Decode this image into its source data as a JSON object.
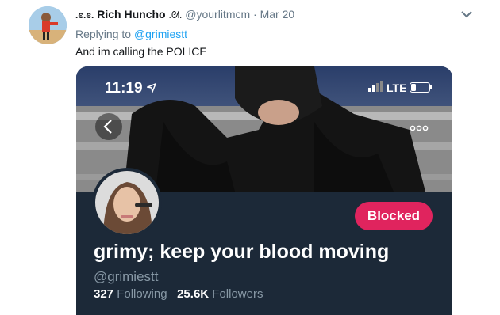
{
  "tweet": {
    "author_name": "Rich Huncho",
    "author_name_prefix_emoji": ".ͼ.ͼ.",
    "author_name_suffix_emoji": ".ᘛ.",
    "author_handle": "@yourlitmcm",
    "separator": "·",
    "date": "Mar 20",
    "reply_prefix": "Replying to",
    "reply_handle": "@grimiestt",
    "text": "And im calling the POLICE"
  },
  "screenshot": {
    "status_time": "11:19",
    "status_network": "LTE",
    "profile_name": "grimy; keep your blood moving",
    "profile_handle": "@grimiestt",
    "blocked_label": "Blocked",
    "following_count": "327",
    "following_label": "Following",
    "followers_count": "25.6K",
    "followers_label": "Followers"
  },
  "colors": {
    "link": "#1da1f2",
    "profile_bg": "#1c2938",
    "blocked": "#e0245e",
    "secondary_text": "#657786"
  },
  "icons": [
    "chevron-down-icon",
    "location-arrow-icon",
    "signal-icon",
    "battery-icon",
    "back-arrow-icon",
    "more-options-icon"
  ]
}
